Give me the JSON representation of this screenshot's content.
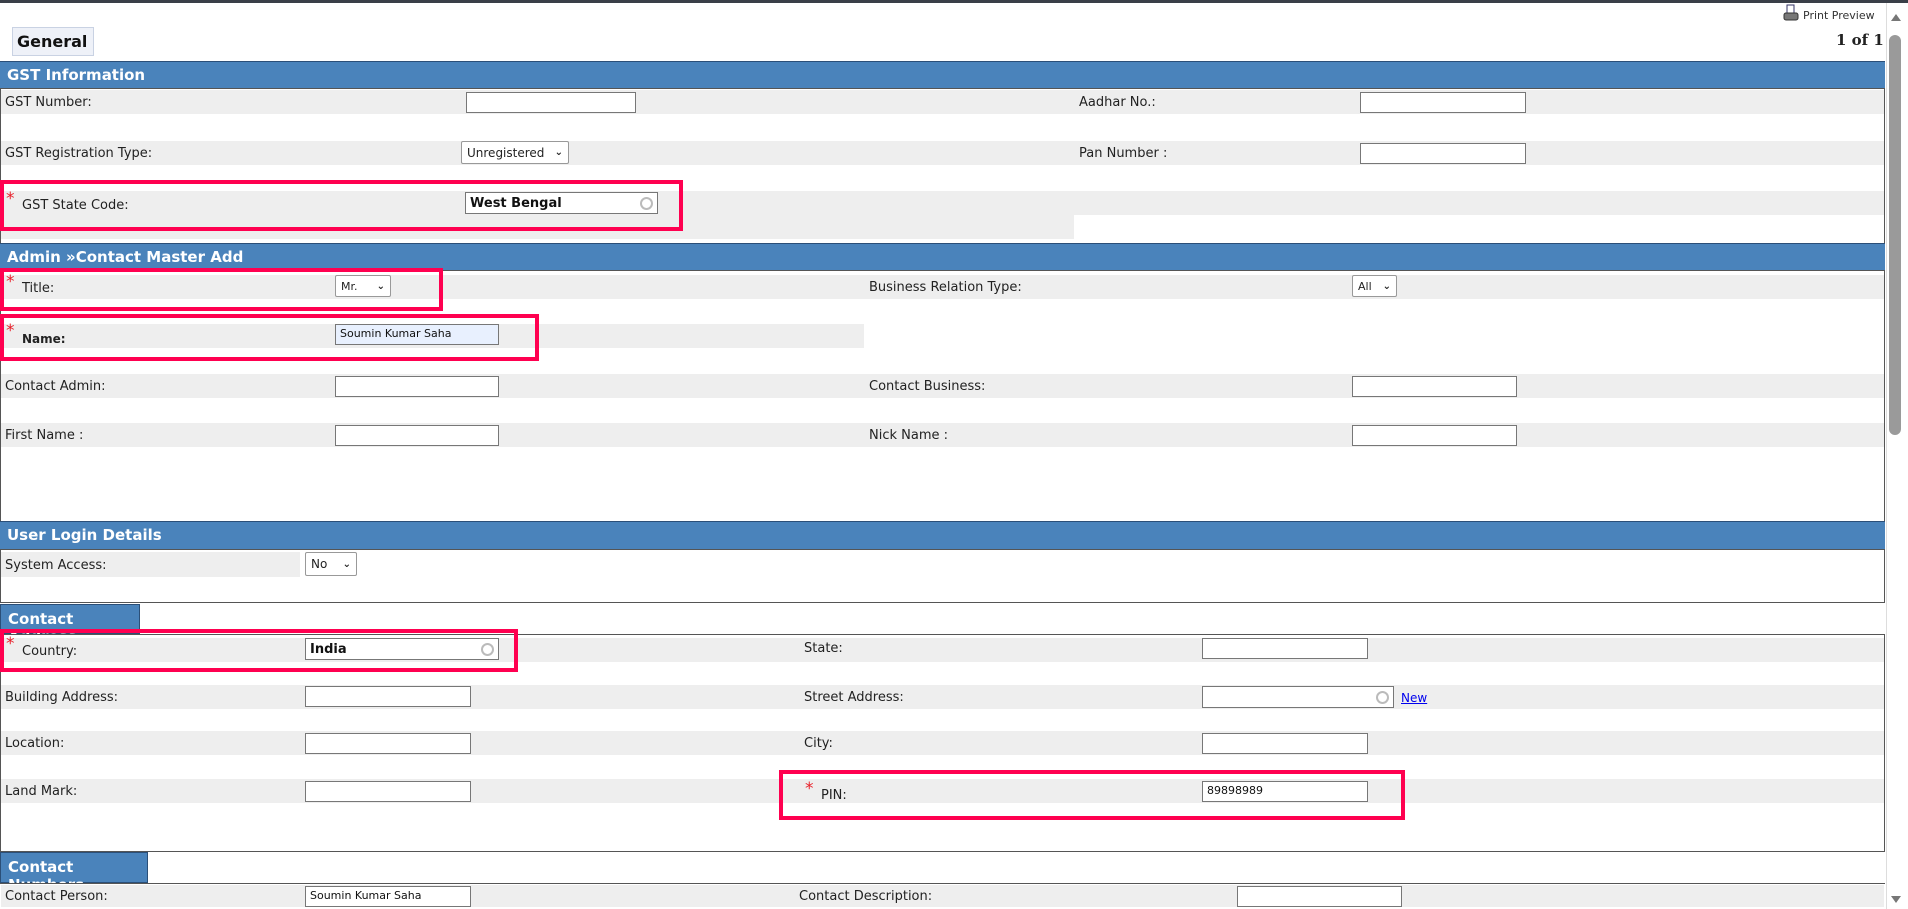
{
  "toolbar": {
    "tab": "General",
    "print_preview": "Print Preview",
    "page": "1 of 1"
  },
  "gst": {
    "title": "GST Information",
    "gst_number_label": "GST Number:",
    "gst_number": "",
    "aadhar_label": "Aadhar No.:",
    "aadhar": "",
    "reg_type_label": "GST Registration Type:",
    "reg_type": "Unregistered",
    "pan_label": "Pan Number :",
    "pan": "",
    "state_code_label": "GST State Code:",
    "state_code": "West Bengal"
  },
  "contact": {
    "title": "Admin »Contact Master Add",
    "title_label": "Title:",
    "title_value": "Mr.",
    "brt_label": "Business Relation Type:",
    "brt_value": "All",
    "name_label": "Name:",
    "name_value": "Soumin Kumar Saha",
    "admin_label": "Contact Admin:",
    "admin_value": "",
    "business_label": "Contact Business:",
    "business_value": "",
    "first_label": "First Name :",
    "first_value": "",
    "nick_label": "Nick Name :",
    "nick_value": ""
  },
  "login": {
    "title": "User Login Details",
    "access_label": "System Access:",
    "access_value": "No"
  },
  "address": {
    "title": "Contact Address",
    "country_label": "Country:",
    "country": "India",
    "state_label": "State:",
    "state": "",
    "building_label": "Building Address:",
    "building": "",
    "street_label": "Street Address:",
    "street": "",
    "new_link": "New",
    "location_label": "Location:",
    "location": "",
    "city_label": "City:",
    "city": "",
    "landmark_label": "Land Mark:",
    "landmark": "",
    "pin_label": "PIN:",
    "pin": "89898989"
  },
  "numbers": {
    "title": "Contact Numbers",
    "person_label": "Contact Person:",
    "person": "Soumin Kumar Saha",
    "desc_label": "Contact Description:",
    "desc": ""
  },
  "required_mark": "*"
}
